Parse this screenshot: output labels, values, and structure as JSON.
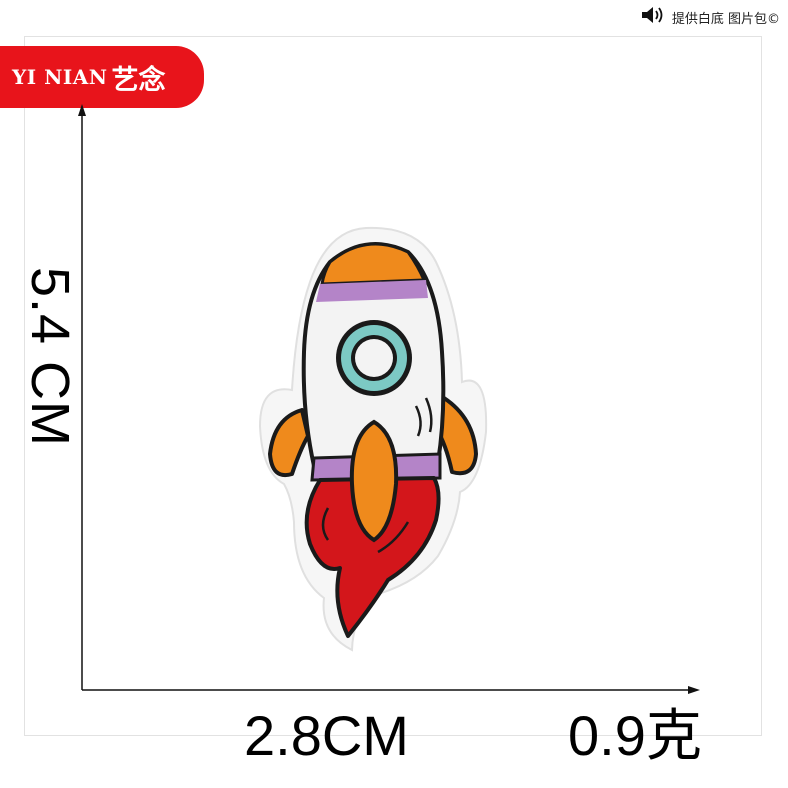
{
  "header": {
    "badge_text": "提供白底 图片包©",
    "icon": "speaker-icon"
  },
  "brand": {
    "latin": "YI NIAN",
    "han": "艺念",
    "color": "#e8141b"
  },
  "dimensions": {
    "height_label": "5.4 CM",
    "width_label": "2.8CM",
    "weight_label": "0.9克"
  },
  "product": {
    "subject": "rocket-patch",
    "colors": {
      "orange": "#ef8a1c",
      "purple": "#b484c8",
      "red": "#d3161b",
      "teal": "#7cc9c4",
      "white": "#f3f3f3",
      "outline": "#1a1a1a"
    }
  }
}
